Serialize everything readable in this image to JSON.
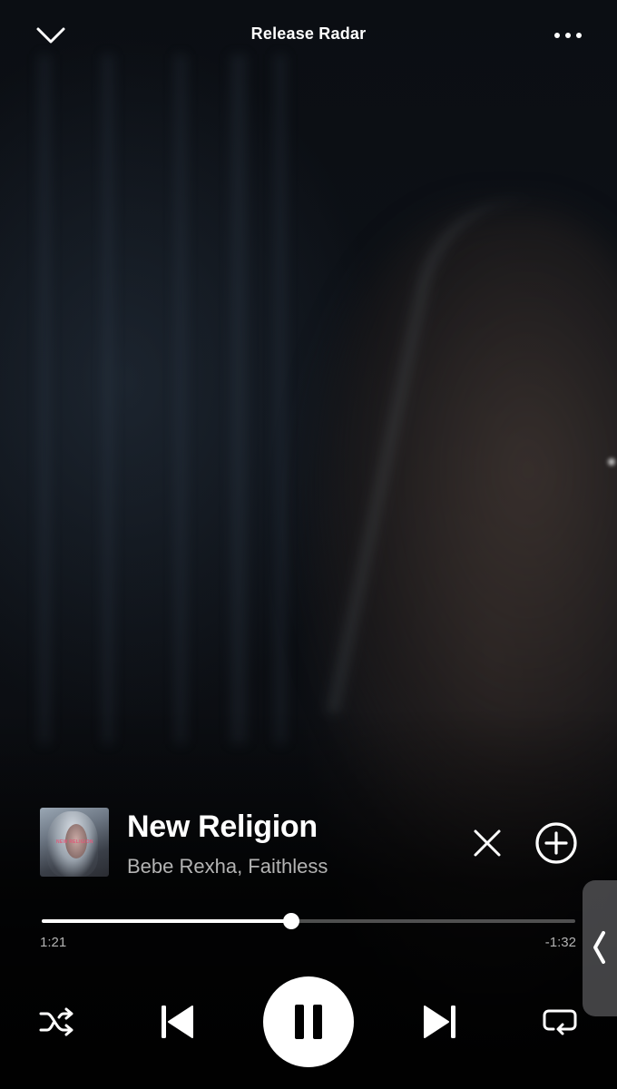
{
  "header": {
    "title": "Release Radar",
    "collapse_icon": "chevron-down-icon",
    "more_icon": "more-options-icon"
  },
  "track": {
    "title": "New Religion",
    "artist": "Bebe Rexha, Faithless",
    "cover_text": "NEW RELIGION",
    "hide_icon": "close-icon",
    "add_icon": "add-circle-icon"
  },
  "playback": {
    "elapsed": "1:21",
    "remaining": "-1:32",
    "progress_fraction": 0.468
  },
  "controls": {
    "shuffle_icon": "shuffle-icon",
    "previous_icon": "skip-previous-icon",
    "play_pause_icon": "pause-icon",
    "next_icon": "skip-next-icon",
    "repeat_icon": "repeat-icon"
  },
  "colors": {
    "text_primary": "#ffffff",
    "text_secondary": "#b3b3b3",
    "progress_track": "rgba(255,255,255,0.3)"
  }
}
